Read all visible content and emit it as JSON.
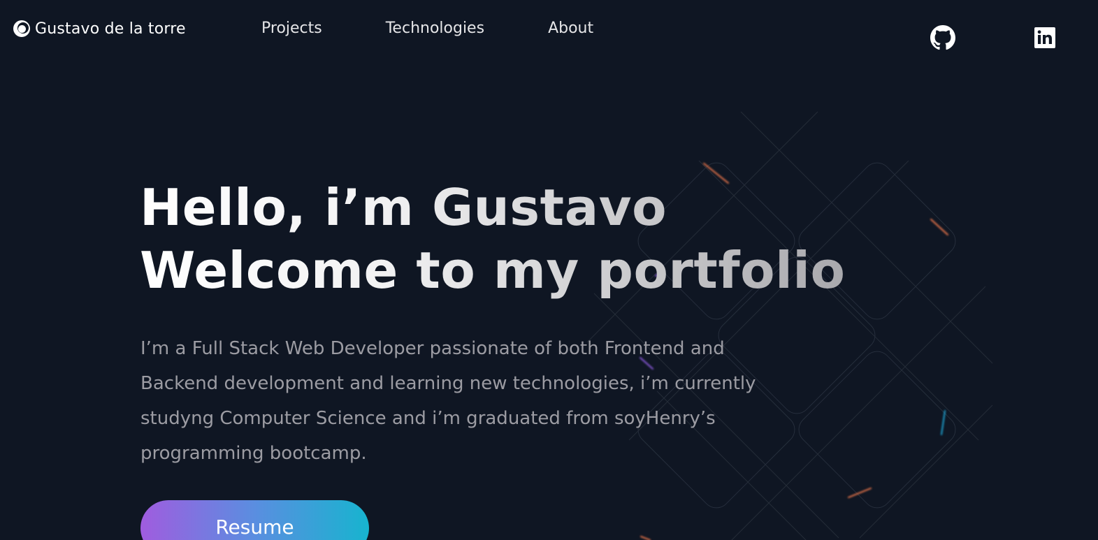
{
  "header": {
    "logo_text": "Gustavo de la torre",
    "nav": [
      {
        "label": "Projects"
      },
      {
        "label": "Technologies"
      },
      {
        "label": "About"
      }
    ],
    "social": [
      {
        "icon": "github-icon"
      },
      {
        "icon": "linkedin-icon"
      }
    ]
  },
  "hero": {
    "title_line1": "Hello, i’m Gustavo",
    "title_line2": "Welcome to my portfolio",
    "description": "I’m a Full Stack Web Developer passionate of both Frontend and Backend development and learning new technologies, i’m currently studyng Computer Science and i’m graduated from soyHenry’s programming bootcamp.",
    "resume_label": "Resume"
  },
  "colors": {
    "background": "#0f1623",
    "button_gradient": [
      "#a05cdf",
      "#5a8ee0",
      "#17b4cf"
    ],
    "text_primary": "#ffffff",
    "text_secondary": "#9c9ca3"
  }
}
